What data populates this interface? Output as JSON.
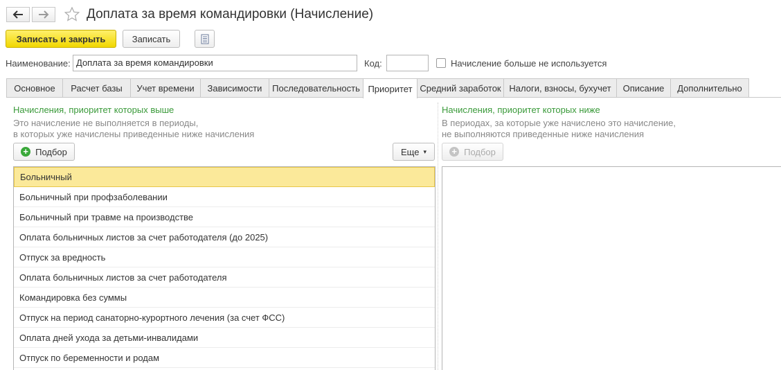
{
  "window": {
    "title": "Доплата за время командировки (Начисление)"
  },
  "nav": {
    "back_icon": "arrow-left-icon",
    "forward_icon": "arrow-right-icon",
    "favorite_icon": "star-icon"
  },
  "toolbar": {
    "save_close_label": "Записать и закрыть",
    "save_label": "Записать",
    "more_icon": "document-list-icon"
  },
  "form": {
    "name_label": "Наименование:",
    "name_value": "Доплата за время командировки",
    "code_label": "Код:",
    "code_value": "",
    "unused_label": "Начисление больше не используется",
    "unused_checked": false
  },
  "tabs": [
    {
      "label": "Основное",
      "active": false
    },
    {
      "label": "Расчет базы",
      "active": false
    },
    {
      "label": "Учет времени",
      "active": false
    },
    {
      "label": "Зависимости",
      "active": false
    },
    {
      "label": "Последовательность",
      "active": false
    },
    {
      "label": "Приоритет",
      "active": true
    },
    {
      "label": "Средний заработок",
      "active": false
    },
    {
      "label": "Налоги, взносы, бухучет",
      "active": false
    },
    {
      "label": "Описание",
      "active": false
    },
    {
      "label": "Дополнительно",
      "active": false
    }
  ],
  "left_panel": {
    "heading": "Начисления, приоритет которых выше",
    "hint_line1": "Это начисление не выполняется в периоды,",
    "hint_line2": "в которых уже начислены приведенные ниже начисления",
    "pick_label": "Подбор",
    "more_label": "Еще",
    "items": [
      "Больничный",
      "Больничный при профзаболевании",
      "Больничный при травме на производстве",
      "Оплата больничных листов за счет работодателя (до 2025)",
      "Отпуск за вредность",
      "Оплата больничных листов за счет работодателя",
      "Командировка без суммы",
      "Отпуск на период санаторно-курортного лечения (за счет ФСС)",
      "Оплата дней ухода за детьми-инвалидами",
      "Отпуск по беременности и родам"
    ],
    "selected_index": 0
  },
  "right_panel": {
    "heading": "Начисления, приоритет которых ниже",
    "hint_line1": "В периодах, за которые уже начислено это начисление,",
    "hint_line2": "не выполняются приведенные ниже начисления",
    "pick_label": "Подбор"
  },
  "colors": {
    "accent_yellow": "#f1d700",
    "heading_green": "#3a9a3a",
    "selection": "#fbe99a"
  }
}
